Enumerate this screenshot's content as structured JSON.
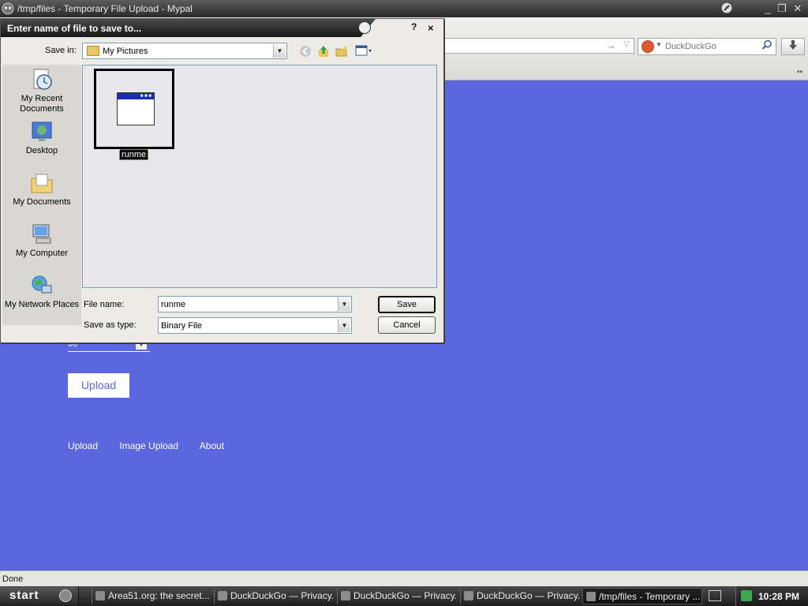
{
  "window": {
    "title": "/tmp/files - Temporary File Upload - Mypal",
    "minimize": "_",
    "restore": "❐",
    "close": "✕"
  },
  "browser": {
    "go_glyph": "→",
    "url_dropdown": "▽",
    "search_engine": "DuckDuckGo"
  },
  "page": {
    "dropdown_value": "66",
    "upload_button": "Upload",
    "links": [
      "Upload",
      "Image Upload",
      "About"
    ]
  },
  "status": {
    "text": "Done"
  },
  "taskbar": {
    "start": "start",
    "tasks": [
      "Area51.org: the secret...",
      "DuckDuckGo — Privacy...",
      "DuckDuckGo — Privacy...",
      "DuckDuckGo — Privacy...",
      "/tmp/files - Temporary ..."
    ],
    "clock": "10:28 PM"
  },
  "dialog": {
    "title": "Enter name of file to save to...",
    "help": "?",
    "close": "×",
    "save_in_label": "Save in:",
    "save_in_value": "My Pictures",
    "places": [
      "My Recent Documents",
      "Desktop",
      "My Documents",
      "My Computer",
      "My Network Places"
    ],
    "files": [
      {
        "name": "runme",
        "selected": true
      }
    ],
    "file_name_label": "File name:",
    "file_name_value": "runme",
    "save_as_type_label": "Save as type:",
    "save_as_type_value": "Binary File",
    "save_button": "Save",
    "cancel_button": "Cancel"
  },
  "colors": {
    "page_background": "#5a67de",
    "selection": "#0a0a0a"
  }
}
